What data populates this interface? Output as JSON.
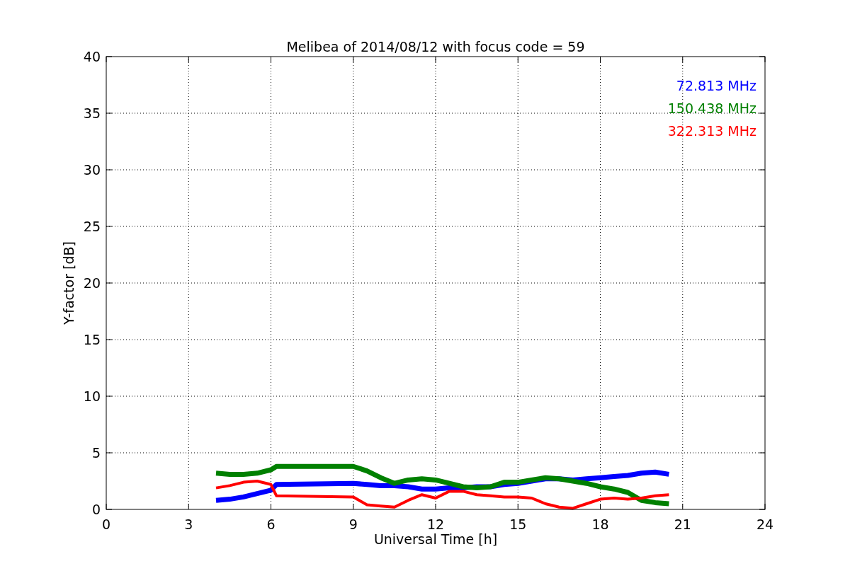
{
  "chart_data": {
    "type": "line",
    "title": "Melibea of 2014/08/12 with focus code = 59",
    "xlabel": "Universal Time [h]",
    "ylabel": "Y-factor [dB]",
    "x": [
      4,
      4.5,
      5,
      5.5,
      6,
      6.2,
      9,
      9.5,
      10,
      10.5,
      11,
      11.5,
      12,
      12.5,
      13,
      13.5,
      14,
      14.5,
      15,
      15.5,
      16,
      16.5,
      17,
      17.5,
      18,
      18.5,
      19,
      19.5,
      20,
      20.5
    ],
    "series": [
      {
        "name": "72.813 MHz",
        "color": "#0000ff",
        "values": [
          0.8,
          0.9,
          1.1,
          1.4,
          1.7,
          2.2,
          2.3,
          2.2,
          2.1,
          2.1,
          2.0,
          1.8,
          1.8,
          1.9,
          1.9,
          2.0,
          2.0,
          2.2,
          2.3,
          2.5,
          2.7,
          2.7,
          2.6,
          2.7,
          2.8,
          2.9,
          3.0,
          3.2,
          3.3,
          3.1
        ]
      },
      {
        "name": "150.438 MHz",
        "color": "#008000",
        "values": [
          3.2,
          3.1,
          3.1,
          3.2,
          3.5,
          3.8,
          3.8,
          3.4,
          2.8,
          2.3,
          2.6,
          2.7,
          2.6,
          2.3,
          2.0,
          1.9,
          2.0,
          2.4,
          2.4,
          2.6,
          2.8,
          2.7,
          2.5,
          2.3,
          2.0,
          1.8,
          1.5,
          0.8,
          0.6,
          0.5
        ]
      },
      {
        "name": "322.313 MHz",
        "color": "#ff0000",
        "values": [
          1.9,
          2.1,
          2.4,
          2.5,
          2.2,
          1.2,
          1.1,
          0.4,
          0.3,
          0.2,
          0.8,
          1.3,
          1.0,
          1.6,
          1.6,
          1.3,
          1.2,
          1.1,
          1.1,
          1.0,
          0.5,
          0.2,
          0.1,
          0.5,
          0.9,
          1.0,
          0.9,
          1.0,
          1.2,
          1.3
        ]
      }
    ],
    "grid": true,
    "xlim": [
      0,
      24
    ],
    "ylim": [
      0,
      40
    ],
    "xticks": [
      0,
      3,
      6,
      9,
      12,
      15,
      18,
      21,
      24
    ],
    "yticks": [
      0,
      5,
      10,
      15,
      20,
      25,
      30,
      35,
      40
    ]
  }
}
